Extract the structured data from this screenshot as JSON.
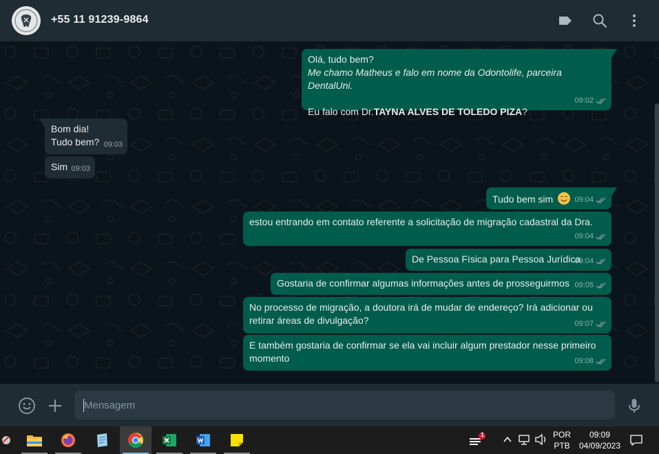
{
  "header": {
    "contact_name": "+55 11 91239-9864",
    "icons": [
      "avatar",
      "label-icon",
      "search-icon",
      "menu-icon"
    ]
  },
  "messages": [
    {
      "direction": "out",
      "line1": "Olá, tudo bem?",
      "line2": "Me chamo Matheus e falo em nome da Odontolife, parceira DentalUni.",
      "line3_prefix": "Eu falo com Dr.",
      "line3_bold": "TAYNA ALVES DE TOLEDO PIZA",
      "line3_suffix": "?",
      "time": "09:02"
    },
    {
      "direction": "in",
      "line1": "Bom dia!",
      "line2": "Tudo bem?",
      "time": "09:03"
    },
    {
      "direction": "in",
      "text": "Sim",
      "time": "09:03"
    },
    {
      "direction": "out",
      "text": "Tudo bem sim",
      "emoji": "smiling-face",
      "time": "09:04"
    },
    {
      "direction": "out",
      "text": "estou entrando em contato referente a solicitação de migração cadastral da Dra.",
      "time": "09:04"
    },
    {
      "direction": "out",
      "text": "De Pessoa Física para Pessoa Jurídica",
      "time": "09:04"
    },
    {
      "direction": "out",
      "text": "Gostaria de confirmar algumas informações antes de prosseguirmos",
      "time": "09:05"
    },
    {
      "direction": "out",
      "line1": "No processo de migração, a doutora irá de mudar de endereço? Irá adicionar ou",
      "line2": "retirar áreas de divulgação?",
      "time": "09:07"
    },
    {
      "direction": "out",
      "line1": "E também gostaria de confirmar se ela vai incluir algum prestador nesse primeiro",
      "line2": "momento",
      "time": "09:08"
    }
  ],
  "composer": {
    "placeholder": "Mensagem",
    "icons": [
      "emoji-icon",
      "attach-plus-icon",
      "microphone-icon"
    ]
  },
  "taskbar": {
    "apps": [
      "app-partial",
      "file-explorer",
      "firefox",
      "notes",
      "chrome",
      "excel",
      "word",
      "sticky-notes"
    ],
    "active_app": "chrome",
    "language_line1": "POR",
    "language_line2": "PTB",
    "time": "09:09",
    "date": "04/09/2023",
    "notification_count": "1"
  },
  "colors": {
    "header_bg": "#202c33",
    "chat_bg": "#0b141a",
    "outgoing_bubble": "#005c4b",
    "incoming_bubble": "#202c33",
    "text": "#e9edef",
    "taskbar_bg": "#1c1c1c"
  }
}
